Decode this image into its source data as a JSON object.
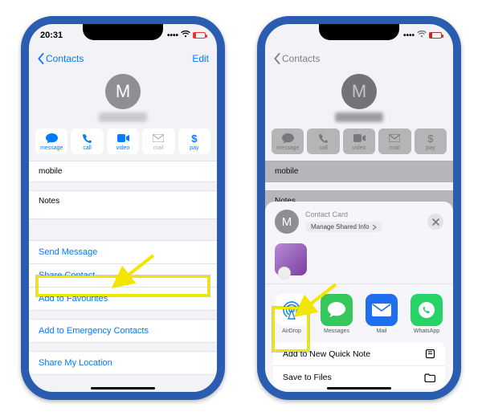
{
  "status": {
    "time": "20:31"
  },
  "nav": {
    "back": "Contacts",
    "edit": "Edit"
  },
  "avatar_initial": "M",
  "actions": {
    "message": "message",
    "call": "call",
    "video": "video",
    "mail": "mail",
    "pay": "pay",
    "pay_symbol": "$"
  },
  "fields": {
    "mobile": "mobile",
    "notes": "Notes"
  },
  "links": {
    "send_message": "Send Message",
    "share_contact": "Share Contact",
    "add_favourites": "Add to Favourites",
    "add_emergency": "Add to Emergency Contacts",
    "share_location": "Share My Location"
  },
  "sheet": {
    "title": "Contact Card",
    "manage": "Manage Shared Info",
    "apps": {
      "airdrop": "AirDrop",
      "messages": "Messages",
      "mail": "Mail",
      "whatsapp": "WhatsApp"
    },
    "options": {
      "quicknote": "Add to New Quick Note",
      "savefiles": "Save to Files"
    }
  }
}
